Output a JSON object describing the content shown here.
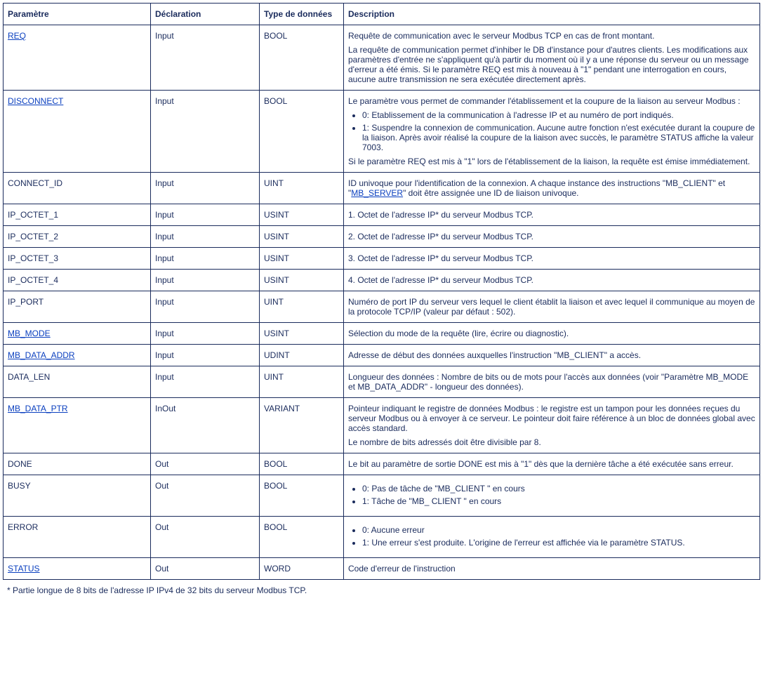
{
  "headers": {
    "param": "Paramètre",
    "decl": "Déclaration",
    "type": "Type de données",
    "desc": "Description"
  },
  "rows": {
    "req": {
      "param": "REQ",
      "decl": "Input",
      "type": "BOOL",
      "p1": "Requête de communication avec le serveur Modbus TCP en cas de front montant.",
      "p2": "La requête de communication permet d'inhiber le DB d'instance pour d'autres clients. Les modifications aux paramètres d'entrée ne s'appliquent qu'à partir du moment où il y a une réponse du serveur ou un message d'erreur a été émis. Si le paramètre REQ est mis à nouveau à \"1\" pendant une interrogation en cours, aucune autre transmission ne sera exécutée directement après."
    },
    "disconnect": {
      "param": "DISCONNECT",
      "decl": "Input",
      "type": "BOOL",
      "p1": "Le paramètre vous permet de commander l'établissement et la coupure de la liaison au serveur Modbus :",
      "li0": "0: Etablissement de la communication à l'adresse IP et au numéro de port indiqués.",
      "li1": "1: Suspendre la connexion de communication. Aucune autre fonction n'est exécutée durant la coupure de la liaison. Après avoir réalisé la coupure de la liaison avec succès, le paramètre STATUS affiche la valeur 7003.",
      "p2": "Si le paramètre REQ est mis à \"1\" lors de l'établissement de la liaison, la requête est émise immédiatement."
    },
    "connect_id": {
      "param": "CONNECT_ID",
      "decl": "Input",
      "type": "UINT",
      "p1a": "ID univoque pour l'identification de la connexion. A chaque instance des instructions \"MB_CLIENT\" et \"",
      "link": "MB_SERVER",
      "p1b": "\" doit être assignée une ID de liaison univoque."
    },
    "ip1": {
      "param": "IP_OCTET_1",
      "decl": "Input",
      "type": "USINT",
      "desc": "1. Octet de l'adresse IP* du serveur Modbus TCP."
    },
    "ip2": {
      "param": "IP_OCTET_2",
      "decl": "Input",
      "type": "USINT",
      "desc": "2. Octet de l'adresse IP* du serveur Modbus TCP."
    },
    "ip3": {
      "param": "IP_OCTET_3",
      "decl": "Input",
      "type": "USINT",
      "desc": "3. Octet de l'adresse IP* du serveur Modbus TCP."
    },
    "ip4": {
      "param": "IP_OCTET_4",
      "decl": "Input",
      "type": "USINT",
      "desc": "4. Octet de l'adresse IP* du serveur Modbus TCP."
    },
    "ip_port": {
      "param": "IP_PORT",
      "decl": "Input",
      "type": "UINT",
      "desc": "Numéro de port IP du serveur vers lequel le client établit la liaison et avec lequel il communique au moyen de la protocole TCP/IP (valeur par défaut : 502)."
    },
    "mb_mode": {
      "param": "MB_MODE",
      "decl": "Input",
      "type": "USINT",
      "desc": "Sélection du mode de la requête (lire, écrire ou diagnostic)."
    },
    "mb_data_addr": {
      "param": "MB_DATA_ADDR",
      "decl": "Input",
      "type": "UDINT",
      "desc": "Adresse de début des données auxquelles l'instruction \"MB_CLIENT\" a accès."
    },
    "data_len": {
      "param": "DATA_LEN",
      "decl": "Input",
      "type": "UINT",
      "desc": "Longueur des données : Nombre de bits ou de mots pour l'accès aux données (voir \"Paramètre MB_MODE et MB_DATA_ADDR\" - longueur des données)."
    },
    "mb_data_ptr": {
      "param": "MB_DATA_PTR",
      "decl": "InOut",
      "type": "VARIANT",
      "p1": "Pointeur indiquant le registre de données Modbus : le registre est un tampon pour les données reçues du serveur Modbus ou à envoyer à ce serveur. Le pointeur doit faire référence à un bloc de données global avec accès standard.",
      "p2": "Le nombre de bits adressés doit être divisible par 8."
    },
    "done": {
      "param": "DONE",
      "decl": "Out",
      "type": "BOOL",
      "desc": "Le bit au paramètre de sortie DONE est mis à \"1\" dès que la dernière tâche a été exécutée sans erreur."
    },
    "busy": {
      "param": "BUSY",
      "decl": "Out",
      "type": "BOOL",
      "li0": "0: Pas de tâche de \"MB_CLIENT \" en cours",
      "li1": "1: Tâche de \"MB_ CLIENT \" en cours"
    },
    "error": {
      "param": "ERROR",
      "decl": "Out",
      "type": "BOOL",
      "li0": "0: Aucune erreur",
      "li1": "1: Une erreur s'est produite. L'origine de l'erreur est affichée via le paramètre STATUS."
    },
    "status": {
      "param": "STATUS",
      "decl": "Out",
      "type": "WORD",
      "desc": "Code d'erreur de l'instruction"
    }
  },
  "footnote": "* Partie longue de 8 bits de l'adresse IP IPv4 de 32 bits du serveur Modbus TCP."
}
